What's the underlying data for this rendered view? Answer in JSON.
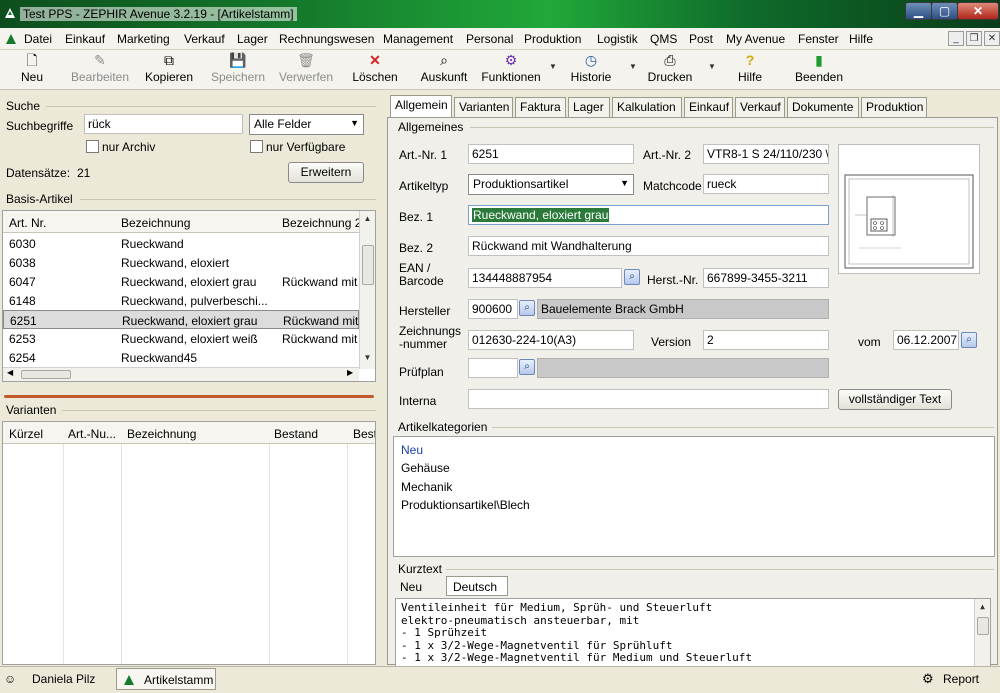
{
  "window": {
    "title": "Test PPS - ZEPHIR Avenue 3.2.19 - [Artikelstamm]"
  },
  "menu": [
    "Datei",
    "Einkauf",
    "Marketing",
    "Verkauf",
    "Lager",
    "Rechnungswesen",
    "Management",
    "Personal",
    "Produktion",
    "Logistik",
    "QMS",
    "Post",
    "My Avenue",
    "Fenster",
    "Hilfe"
  ],
  "toolbar": {
    "neu": "Neu",
    "bearbeiten": "Bearbeiten",
    "kopieren": "Kopieren",
    "speichern": "Speichern",
    "verwerfen": "Verwerfen",
    "loeschen": "Löschen",
    "auskunft": "Auskunft",
    "funktionen": "Funktionen",
    "historie": "Historie",
    "drucken": "Drucken",
    "hilfe": "Hilfe",
    "beenden": "Beenden"
  },
  "search": {
    "heading": "Suche",
    "terms_label": "Suchbegriffe",
    "terms_value": "rück",
    "field_select": "Alle Felder",
    "archive_label": "nur Archiv",
    "available_label": "nur Verfügbare",
    "count_label": "Datensätze:",
    "count": "21",
    "expand_button": "Erweitern"
  },
  "basis": {
    "heading": "Basis-Artikel",
    "columns": [
      "Art. Nr.",
      "Bezeichnung",
      "Bezeichnung 2"
    ],
    "rows": [
      [
        "6030",
        "Rueckwand",
        ""
      ],
      [
        "6038",
        "Rueckwand, eloxiert",
        ""
      ],
      [
        "6047",
        "Rueckwand, eloxiert grau",
        "Rückwand mit"
      ],
      [
        "6148",
        "Rueckwand, pulverbeschi...",
        ""
      ],
      [
        "6251",
        "Rueckwand, eloxiert grau",
        "Rückwand mit"
      ],
      [
        "6253",
        "Rueckwand, eloxiert weiß",
        "Rückwand mit"
      ],
      [
        "6254",
        "Rueckwand45",
        ""
      ]
    ]
  },
  "variants": {
    "heading": "Varianten",
    "columns": [
      "Kürzel",
      "Art.-Nu...",
      "Bezeichnung",
      "Bestand",
      "Best"
    ]
  },
  "tabs": [
    "Allgemein",
    "Varianten",
    "Faktura",
    "Lager",
    "Kalkulation",
    "Einkauf",
    "Verkauf",
    "Dokumente",
    "Produktion"
  ],
  "general": {
    "heading": "Allgemeines",
    "artnr1_label": "Art.-Nr. 1",
    "artnr1": "6251",
    "artnr2_label": "Art.-Nr. 2",
    "artnr2": "VTR8-1 S 24/110/230 \\",
    "type_label": "Artikeltyp",
    "type": "Produktionsartikel",
    "matchcode_label": "Matchcode",
    "matchcode": "rueck",
    "bez1_label": "Bez. 1",
    "bez1": "Rueckwand, eloxiert grau",
    "bez2_label": "Bez. 2",
    "bez2": "Rückwand mit Wandhalterung",
    "ean_label": "EAN /\nBarcode",
    "ean": "134448887954",
    "herstnr_label": "Herst.-Nr.",
    "herstnr": "667899-3455-3211",
    "hersteller_label": "Hersteller",
    "hersteller_nr": "900600",
    "hersteller_name": "Bauelemente Brack GmbH",
    "zeichnung_label": "Zeichnungs\n-nummer",
    "zeichnung": "012630-224-10(A3)",
    "version_label": "Version",
    "version": "2",
    "vom_label": "vom",
    "vom": "06.12.2007",
    "pruefplan_label": "Prüfplan",
    "interna_label": "Interna",
    "fulltext_button": "vollständiger Text"
  },
  "categories": {
    "heading": "Artikelkategorien",
    "items": [
      "Neu",
      "Gehäuse",
      "Mechanik",
      "Produktionsartikel\\Blech"
    ]
  },
  "kurztext": {
    "heading": "Kurztext",
    "tabs": [
      "Neu",
      "Deutsch"
    ],
    "lines": [
      "Ventileinheit für Medium, Sprüh- und Steuerluft",
      "elektro-pneumatisch ansteuerbar, mit",
      "- 1 Sprühzeit",
      "- 1 x 3/2-Wege-Magnetventil für Sprühluft",
      "- 1 x 3/2-Wege-Magnetventil für Medium und Steuerluft"
    ]
  },
  "statusbar": {
    "user": "Daniela Pilz",
    "window": "Artikelstamm",
    "report": "Report"
  },
  "colors": {
    "accent_link": "#1b3ea8",
    "selection_green": "#2a7a39",
    "title_green": "#157a2b"
  }
}
